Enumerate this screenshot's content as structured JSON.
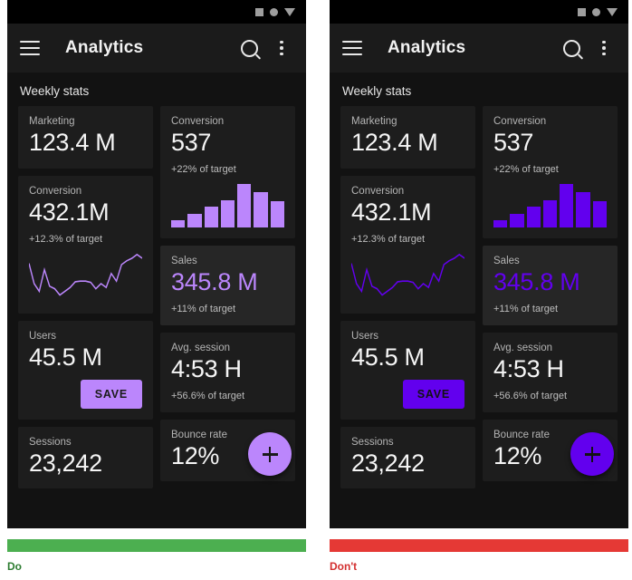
{
  "examples": [
    {
      "kind": "do",
      "caption": "Do",
      "rule_color": "#4CAF50",
      "caption_color": "#2E7D32",
      "accent": "#BB86FC",
      "accent_text": "#BB86FC",
      "on_accent": "#1A1A1A",
      "statusbar": {
        "icons": [
          "square-icon",
          "circle-icon",
          "triangle-down-icon"
        ]
      },
      "appbar": {
        "menu_icon": "hamburger-menu-icon",
        "title": "Analytics",
        "search_icon": "search-icon",
        "overflow_icon": "overflow-menu-icon"
      },
      "section_title": "Weekly stats",
      "cards": {
        "marketing": {
          "label": "Marketing",
          "value": "123.4 M"
        },
        "conversion_l": {
          "label": "Conversion",
          "value": "432.1M",
          "sub": "+12.3% of target"
        },
        "users": {
          "label": "Users",
          "value": "45.5 M",
          "save_label": "SAVE"
        },
        "sessions": {
          "label": "Sessions",
          "value": "23,242"
        },
        "conversion_r": {
          "label": "Conversion",
          "value": "537",
          "sub": "+22% of target"
        },
        "sales": {
          "label": "Sales",
          "value": "345.8 M",
          "sub": "+11% of target"
        },
        "avg_session": {
          "label": "Avg. session",
          "value": "4:53 H",
          "sub": "+56.6% of target"
        },
        "bounce": {
          "label": "Bounce rate",
          "value": "12%"
        }
      },
      "fab": {
        "icon": "plus-icon"
      }
    },
    {
      "kind": "dont",
      "caption": "Don't",
      "rule_color": "#E53935",
      "caption_color": "#D32F2F",
      "accent": "#6200EE",
      "accent_text": "#6200EE",
      "on_accent": "#121212",
      "statusbar": {
        "icons": [
          "square-icon",
          "circle-icon",
          "triangle-down-icon"
        ]
      },
      "appbar": {
        "menu_icon": "hamburger-menu-icon",
        "title": "Analytics",
        "search_icon": "search-icon",
        "overflow_icon": "overflow-menu-icon"
      },
      "section_title": "Weekly stats",
      "cards": {
        "marketing": {
          "label": "Marketing",
          "value": "123.4 M"
        },
        "conversion_l": {
          "label": "Conversion",
          "value": "432.1M",
          "sub": "+12.3% of target"
        },
        "users": {
          "label": "Users",
          "value": "45.5 M",
          "save_label": "SAVE"
        },
        "sessions": {
          "label": "Sessions",
          "value": "23,242"
        },
        "conversion_r": {
          "label": "Conversion",
          "value": "537",
          "sub": "+22% of target"
        },
        "sales": {
          "label": "Sales",
          "value": "345.8 M",
          "sub": "+11% of target"
        },
        "avg_session": {
          "label": "Avg. session",
          "value": "4:53 H",
          "sub": "+56.6% of target"
        },
        "bounce": {
          "label": "Bounce rate",
          "value": "12%"
        }
      },
      "fab": {
        "icon": "plus-icon"
      }
    }
  ],
  "chart_data": [
    {
      "type": "bar",
      "title": "Conversion weekly bars",
      "categories": [
        "1",
        "2",
        "3",
        "4",
        "5",
        "6",
        "7"
      ],
      "values": [
        12,
        22,
        34,
        44,
        70,
        56,
        42
      ],
      "ylim": [
        0,
        70
      ],
      "xlabel": "",
      "ylabel": "",
      "grid": false,
      "legend": "none"
    },
    {
      "type": "line",
      "title": "Conversion trend sparkline",
      "x": [
        0,
        1,
        2,
        3,
        4,
        5,
        6,
        7,
        8,
        9,
        10,
        11,
        12,
        13,
        14,
        15,
        16,
        17,
        18,
        19,
        20,
        21,
        22
      ],
      "y": [
        62,
        30,
        18,
        52,
        26,
        22,
        12,
        18,
        24,
        33,
        34,
        34,
        32,
        22,
        30,
        24,
        46,
        34,
        60,
        66,
        70,
        76,
        70
      ],
      "ylim": [
        0,
        80
      ],
      "xlabel": "",
      "ylabel": "",
      "grid": false,
      "legend": "none"
    }
  ]
}
